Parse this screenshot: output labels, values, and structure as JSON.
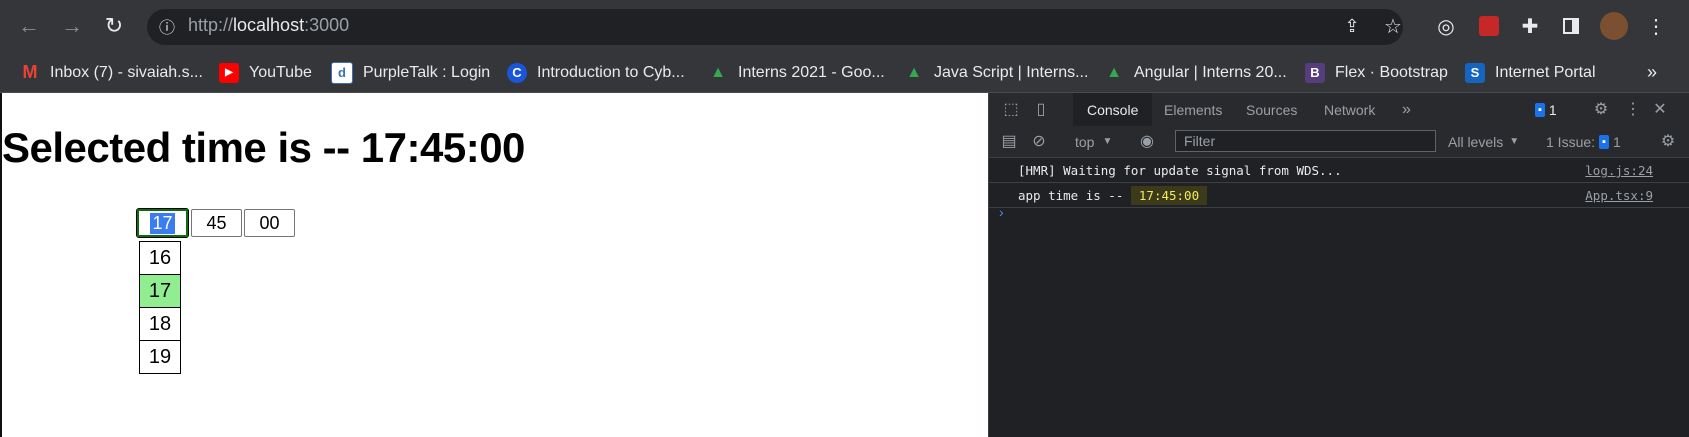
{
  "browser": {
    "url_scheme": "http://",
    "url_host": "localhost",
    "url_port": ":3000",
    "back_icon": "back-arrow-icon",
    "forward_icon": "forward-arrow-icon",
    "reload_icon": "reload-icon",
    "info_icon": "site-info-icon",
    "share_icon": "share-icon",
    "star_icon": "star-icon",
    "extensions": [
      "target-extension-icon",
      "red-extension-icon",
      "puzzle-extensions-icon",
      "side-panel-icon"
    ],
    "menu_icon": "more-vert-icon",
    "bookmarks": [
      {
        "label": "Inbox (7) - sivaiah.s...",
        "icon": "gmail-icon",
        "color": "#ea4335",
        "glyph": "M"
      },
      {
        "label": "YouTube",
        "icon": "youtube-icon",
        "color": "#ff0000",
        "glyph": "▶"
      },
      {
        "label": "PurpleTalk : Login",
        "icon": "purpletalk-icon",
        "color": "#3b6fb6",
        "glyph": "d"
      },
      {
        "label": "Introduction to Cyb...",
        "icon": "coursera-icon",
        "color": "#1a56db",
        "glyph": "C"
      },
      {
        "label": "Interns 2021 - Goo...",
        "icon": "google-drive-icon",
        "color": "#34a853",
        "glyph": "▲"
      },
      {
        "label": "Java Script | Interns...",
        "icon": "google-drive-icon",
        "color": "#34a853",
        "glyph": "▲"
      },
      {
        "label": "Angular | Interns 20...",
        "icon": "google-drive-icon",
        "color": "#34a853",
        "glyph": "▲"
      },
      {
        "label": "Flex · Bootstrap",
        "icon": "bootstrap-icon",
        "color": "#563d7c",
        "glyph": "B"
      },
      {
        "label": "Internet Portal",
        "icon": "portal-icon",
        "color": "#1565c0",
        "glyph": "S"
      }
    ],
    "bookmarks_overflow": "»"
  },
  "page": {
    "title": "Selected time is -- 17:45:00",
    "hours": "17",
    "minutes": "45",
    "seconds": "00",
    "hour_options": [
      "16",
      "17",
      "18",
      "19"
    ],
    "selected_hour": "17"
  },
  "devtools": {
    "tabs": [
      "Console",
      "Elements",
      "Sources",
      "Network"
    ],
    "more_tabs": "»",
    "issues_badge": "1",
    "context": "top",
    "filter_placeholder": "Filter",
    "levels": "All levels",
    "issues_label": "1 Issue:",
    "issues_count": "1",
    "logs": [
      {
        "prefix": "[HMR] Waiting for update signal from WDS...",
        "value": "",
        "source": "log.js:24"
      },
      {
        "prefix": "app time is -- ",
        "value": "17:45:00",
        "source": "App.tsx:9"
      }
    ],
    "prompt": "›"
  }
}
